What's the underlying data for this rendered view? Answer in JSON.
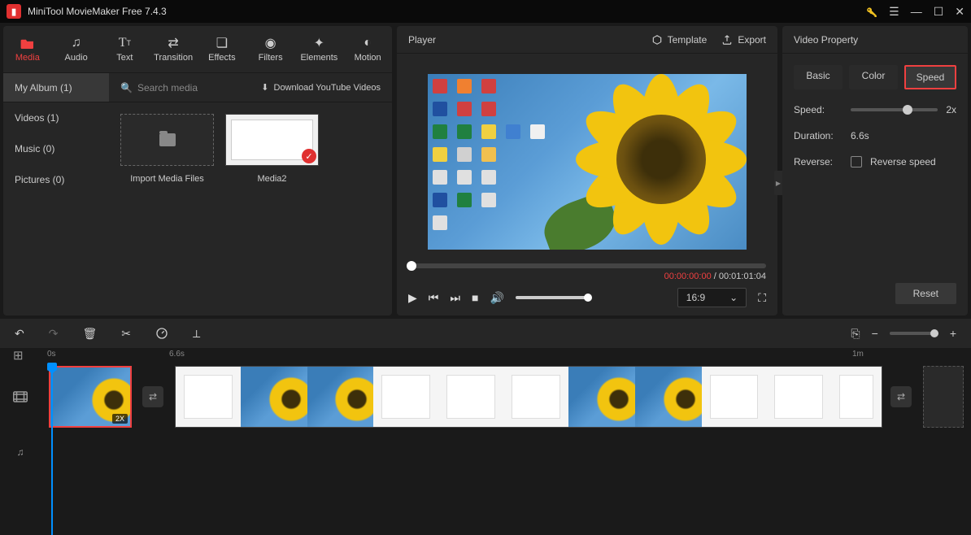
{
  "app": {
    "title": "MiniTool MovieMaker Free 7.4.3"
  },
  "tool_tabs": [
    {
      "id": "media",
      "label": "Media",
      "active": true
    },
    {
      "id": "audio",
      "label": "Audio"
    },
    {
      "id": "text",
      "label": "Text"
    },
    {
      "id": "transition",
      "label": "Transition"
    },
    {
      "id": "effects",
      "label": "Effects"
    },
    {
      "id": "filters",
      "label": "Filters"
    },
    {
      "id": "elements",
      "label": "Elements"
    },
    {
      "id": "motion",
      "label": "Motion"
    }
  ],
  "album": {
    "name": "My Album (1)",
    "search_placeholder": "Search media",
    "download_label": "Download YouTube Videos"
  },
  "sidebar_items": [
    {
      "label": "Videos (1)"
    },
    {
      "label": "Music (0)"
    },
    {
      "label": "Pictures (0)"
    }
  ],
  "media_items": {
    "import_label": "Import Media Files",
    "item1_label": "Media2"
  },
  "player": {
    "title": "Player",
    "template_label": "Template",
    "export_label": "Export",
    "current_time": "00:00:00:00",
    "total_time": "00:01:01:04",
    "aspect": "16:9"
  },
  "property": {
    "title": "Video Property",
    "tabs": {
      "basic": "Basic",
      "color": "Color",
      "speed": "Speed"
    },
    "speed_label": "Speed:",
    "speed_value": "2x",
    "duration_label": "Duration:",
    "duration_value": "6.6s",
    "reverse_label": "Reverse:",
    "reverse_check_label": "Reverse speed",
    "reset_label": "Reset"
  },
  "timeline": {
    "mark_0": "0s",
    "mark_1": "6.6s",
    "mark_2": "1m",
    "speed_badge": "2X"
  }
}
